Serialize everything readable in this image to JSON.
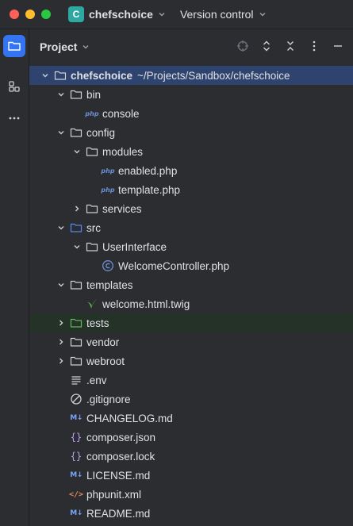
{
  "titlebar": {
    "project_badge": "C",
    "project_name": "chefschoice",
    "vcs_label": "Version control"
  },
  "panel": {
    "title": "Project"
  },
  "tree": {
    "root": {
      "label": "chefschoice",
      "path": "~/Projects/Sandbox/chefschoice"
    },
    "bin": "bin",
    "console": "console",
    "config": "config",
    "modules": "modules",
    "enabled": "enabled.php",
    "template_php": "template.php",
    "services": "services",
    "src": "src",
    "userinterface": "UserInterface",
    "welcomecontroller": "WelcomeController.php",
    "templates": "templates",
    "welcome_twig": "welcome.html.twig",
    "tests": "tests",
    "vendor": "vendor",
    "webroot": "webroot",
    "env": ".env",
    "gitignore": ".gitignore",
    "changelog": "CHANGELOG.md",
    "composer_json": "composer.json",
    "composer_lock": "composer.lock",
    "license": "LICENSE.md",
    "phpunit": "phpunit.xml",
    "readme": "README.md"
  },
  "icons": {
    "php_glyph": "php",
    "md_glyph": "M↓",
    "json_glyph": "{}",
    "xml_glyph": "</>"
  },
  "colors": {
    "accent": "#3574f0",
    "selection": "#2e436e",
    "highlight_row": "#253227",
    "project_badge": "#2fa8a2"
  }
}
